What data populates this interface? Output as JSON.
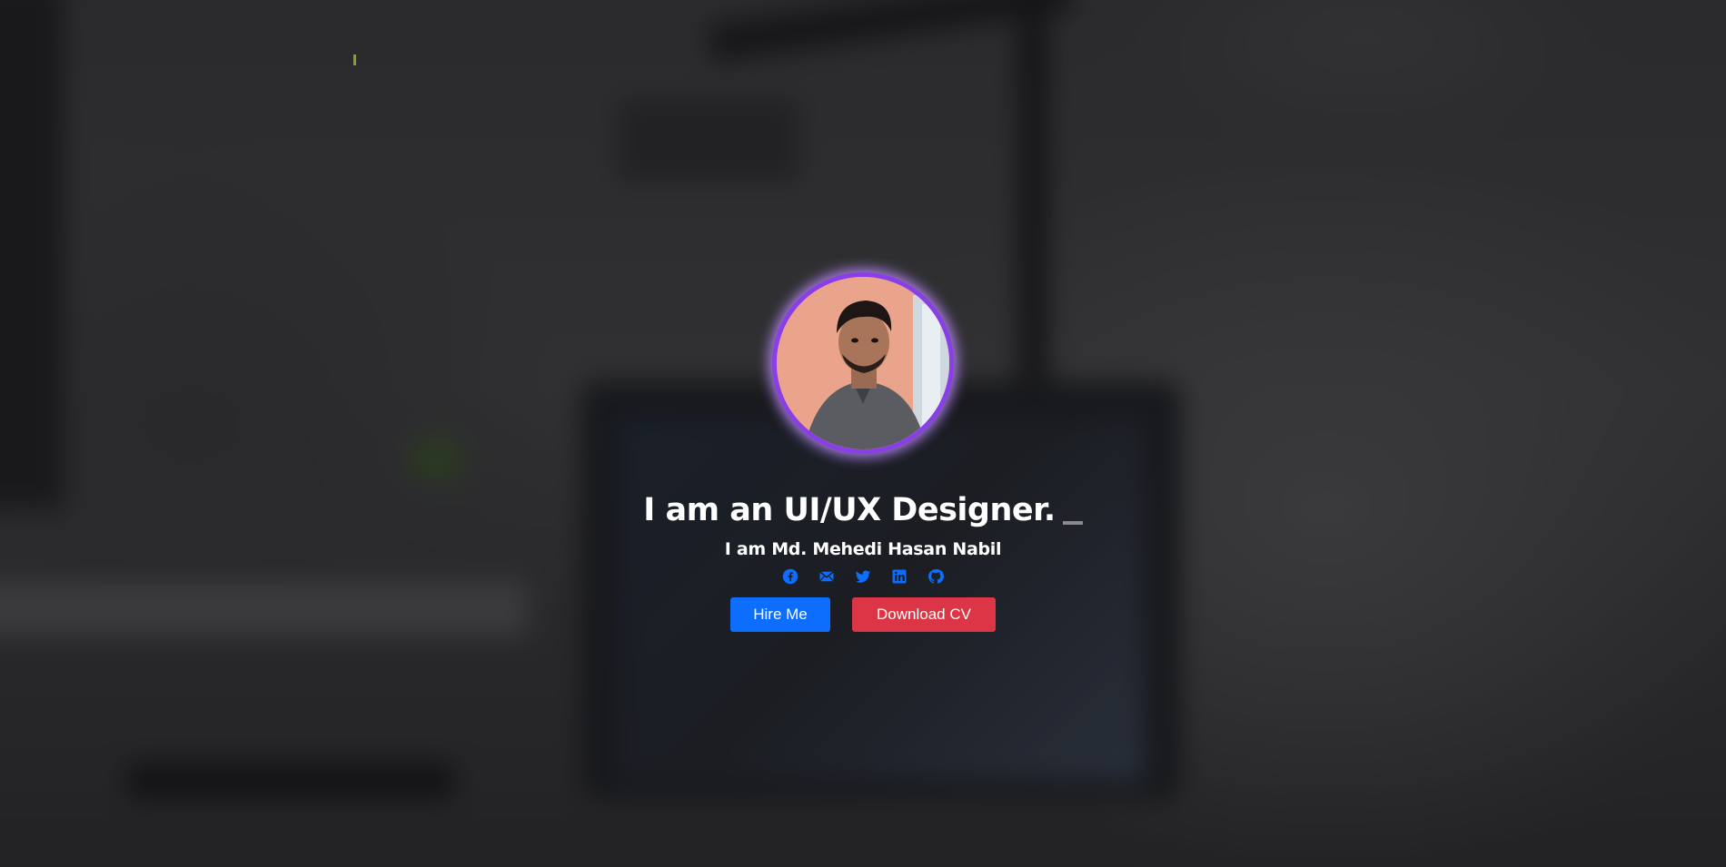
{
  "hero": {
    "headline": "I am an UI/UX Designer.",
    "subtitle": "I am Md. Mehedi Hasan Nabil",
    "avatar_alt": "Profile photo",
    "social_links": [
      {
        "icon": "facebook-icon"
      },
      {
        "icon": "mail-icon"
      },
      {
        "icon": "twitter-icon"
      },
      {
        "icon": "linkedin-icon"
      },
      {
        "icon": "github-icon"
      }
    ],
    "hire_label": "Hire Me",
    "download_label": "Download CV"
  },
  "colors": {
    "avatar_ring": "#8a3ee8",
    "primary": "#0d6efd",
    "danger": "#dc3545",
    "icon": "#0d6efd"
  }
}
